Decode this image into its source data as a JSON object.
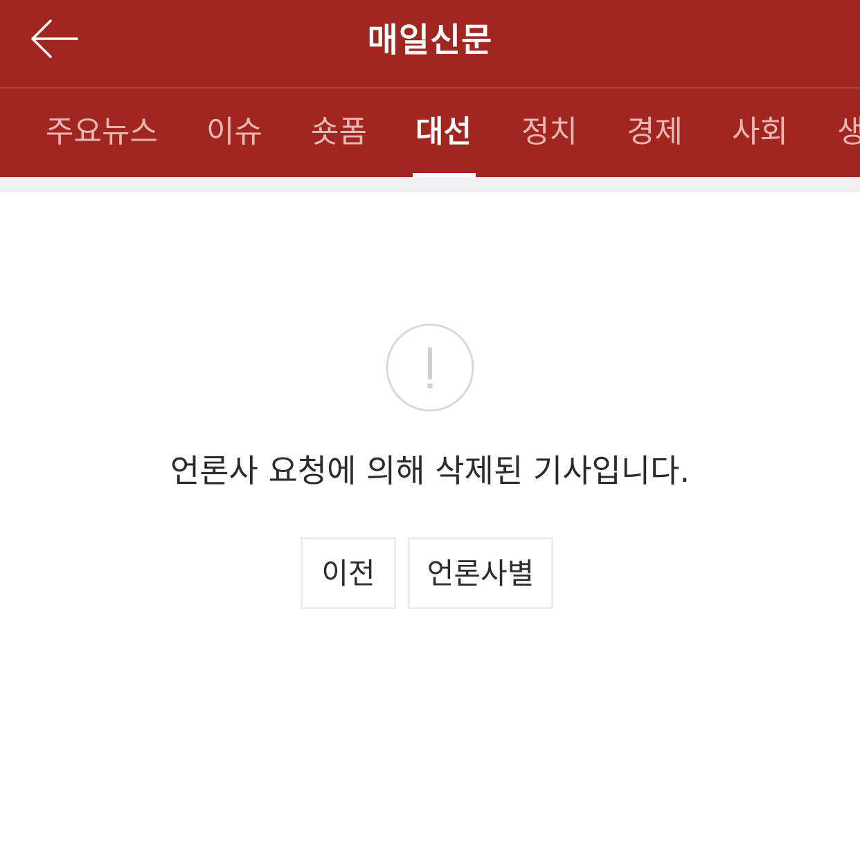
{
  "header": {
    "title": "매일신문",
    "background_color": "#a1261f"
  },
  "tabs": [
    {
      "label": "주요뉴스"
    },
    {
      "label": "이슈"
    },
    {
      "label": "숏폼"
    },
    {
      "label": "대선"
    },
    {
      "label": "정치"
    },
    {
      "label": "경제"
    },
    {
      "label": "사회"
    },
    {
      "label": "생"
    }
  ],
  "active_tab": "대선",
  "notice": {
    "icon": "exclamation-circle-icon",
    "message": "언론사 요청에 의해 삭제된 기사입니다."
  },
  "buttons": {
    "prev_label": "이전",
    "press_label": "언론사별"
  }
}
